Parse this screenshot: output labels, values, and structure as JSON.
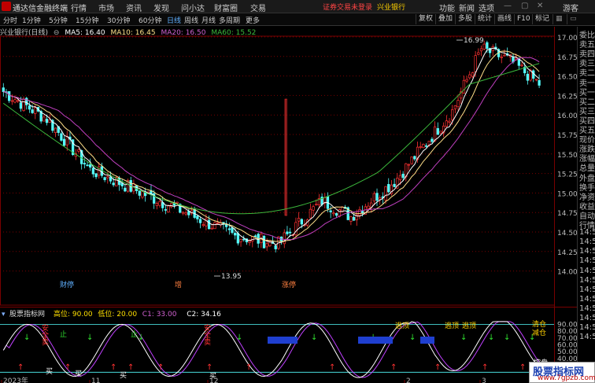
{
  "app": {
    "title": "通达信金融终端"
  },
  "menu": [
    "行情",
    "市场",
    "资讯",
    "发现",
    "问小达",
    "财富圈",
    "交易"
  ],
  "notice": {
    "text": "证券交易未登录",
    "stock": "兴业银行"
  },
  "top_right": [
    "功能",
    "新闻",
    "选项"
  ],
  "user": "游客",
  "periods": [
    "分时",
    "1分钟",
    "5分钟",
    "15分钟",
    "30分钟",
    "60分钟",
    "日线",
    "周线",
    "月线",
    "多周期",
    "更多"
  ],
  "active_period": "日线",
  "tools": [
    "复权",
    "叠加",
    "多股",
    "统计",
    "画线",
    "F10",
    "标记"
  ],
  "ma_legend": {
    "title": "兴业银行(日线)",
    "ma5": "MA5: 16.40",
    "ma10": "MA10: 16.45",
    "ma20": "MA20: 16.50",
    "ma60": "MA60: 15.52"
  },
  "colors": {
    "up": "#ff3232",
    "down": "#54fcfc",
    "ma5": "#ffffff",
    "ma10": "#ffe08a",
    "ma20": "#c040c0",
    "ma60": "#3cb83c",
    "grid": "#7a0000"
  },
  "price_axis": [
    "17.00",
    "16.75",
    "16.50",
    "16.25",
    "16.00",
    "15.75",
    "15.50",
    "15.25",
    "15.00",
    "14.75",
    "14.50",
    "14.25",
    "14.00"
  ],
  "price_marks": {
    "high": "16.99",
    "low": "13.95"
  },
  "event_labels": [
    "财",
    "增",
    "停",
    "涨停"
  ],
  "indicator": {
    "name": "股票指标网",
    "params": [
      "高位: 90.00",
      "低位: 20.00",
      "C1: 33.00",
      "C2: 34.16"
    ],
    "axis": [
      "90.00",
      "80.00",
      "70.00",
      "60.00",
      "50.00",
      "40.00",
      "30.00",
      "20.00"
    ],
    "labels": {
      "sell1": "安全卖",
      "sell2": "安全卖",
      "stop": "止",
      "buy": "买",
      "escape": "逃顶",
      "add": "清仓减仓",
      "control": "控盘"
    }
  },
  "date_axis": [
    "2023年",
    "11",
    "12",
    "2",
    "3"
  ],
  "side_panel": [
    "委比",
    "卖五",
    "卖四",
    "卖三",
    "卖二",
    "卖一",
    "买一",
    "买二",
    "买三",
    "买四",
    "买五",
    "现价",
    "涨跌",
    "涨幅",
    "总量",
    "外盘",
    "换手",
    "净资",
    "收益",
    "自动",
    "行情",
    "14:5",
    "14:5",
    "14:5",
    "14:5",
    "14:5",
    "14:5",
    "14:5",
    "14:5",
    "14:5",
    "14:5",
    "14:5",
    "14:5"
  ],
  "watermark": {
    "title": "股票指标网",
    "url": "www.7gpzb.com"
  }
}
